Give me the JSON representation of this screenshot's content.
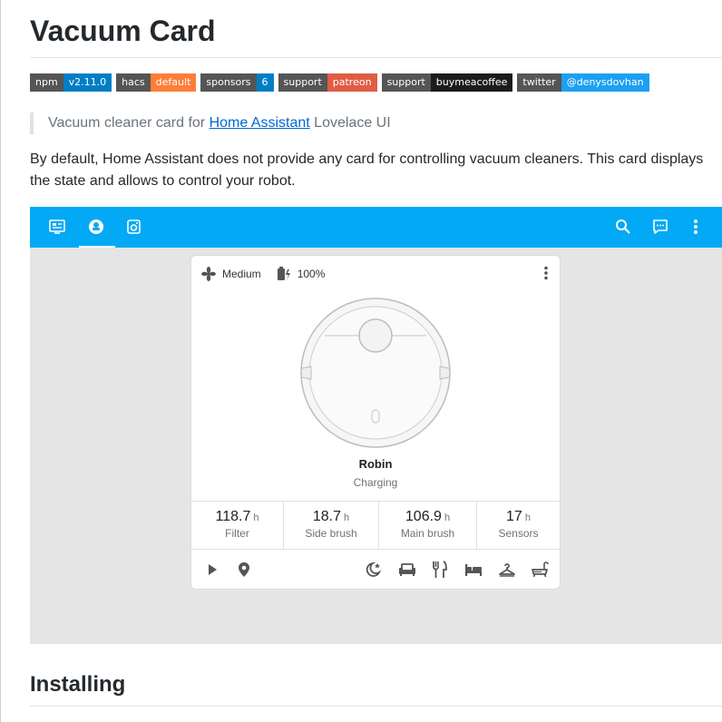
{
  "title": "Vacuum Card",
  "badges": [
    {
      "key": "npm",
      "value": "v2.11.0",
      "color": "#007ec6"
    },
    {
      "key": "hacs",
      "value": "default",
      "color": "#fe7d37"
    },
    {
      "key": "sponsors",
      "value": "6",
      "color": "#007ec6"
    },
    {
      "key": "support",
      "value": "patreon",
      "color": "#e05d44"
    },
    {
      "key": "support",
      "value": "buymeacoffee",
      "color": "#1c1c1c"
    },
    {
      "key": "twitter",
      "value": "@denysdovhan",
      "color": "#1ca0f2"
    }
  ],
  "quote": {
    "prefix": "Vacuum cleaner card for ",
    "link": "Home Assistant",
    "suffix": " Lovelace UI"
  },
  "intro": "By default, Home Assistant does not provide any card for controlling vacuum cleaners. This card displays the state and allows to control your robot.",
  "screenshot": {
    "topbar_color": "#03a9f4",
    "card": {
      "fan_speed": "Medium",
      "battery": "100%",
      "name": "Robin",
      "status": "Charging",
      "stats": [
        {
          "value": "118.7",
          "unit": "h",
          "label": "Filter"
        },
        {
          "value": "18.7",
          "unit": "h",
          "label": "Side brush"
        },
        {
          "value": "106.9",
          "unit": "h",
          "label": "Main brush"
        },
        {
          "value": "17",
          "unit": "h",
          "label": "Sensors"
        }
      ],
      "actions": [
        "play-icon",
        "map-marker-icon"
      ],
      "shortcuts": [
        "sleep-icon",
        "sofa-icon",
        "utensils-icon",
        "bed-icon",
        "hanger-icon",
        "bathtub-icon"
      ]
    }
  },
  "section_heading": "Installing"
}
